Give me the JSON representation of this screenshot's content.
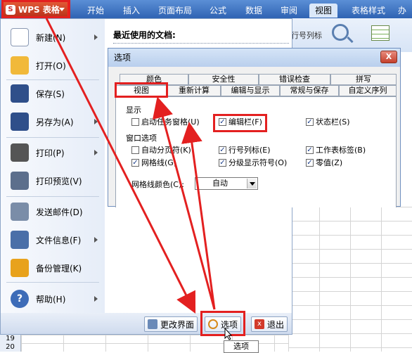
{
  "ribbon": {
    "app_label": "WPS 表格",
    "tabs": [
      "开始",
      "插入",
      "页面布局",
      "公式",
      "数据",
      "审阅",
      "视图",
      "表格样式",
      "办"
    ],
    "active_tab": "视图",
    "rowcol_label": "行号列标"
  },
  "menu": {
    "items": [
      {
        "label": "新建(N)",
        "icon": "new-file-icon",
        "color": "#ffffff",
        "arrow": true
      },
      {
        "label": "打开(O)",
        "icon": "folder-open-icon",
        "color": "#f1b93a",
        "arrow": false
      },
      {
        "label": "保存(S)",
        "icon": "save-icon",
        "color": "#2f4f8a",
        "arrow": false
      },
      {
        "label": "另存为(A)",
        "icon": "save-as-icon",
        "color": "#2f4f8a",
        "arrow": true
      },
      {
        "label": "打印(P)",
        "icon": "printer-icon",
        "color": "#555555",
        "arrow": true
      },
      {
        "label": "打印预览(V)",
        "icon": "print-preview-icon",
        "color": "#5c6f8c",
        "arrow": false
      },
      {
        "label": "发送邮件(D)",
        "icon": "mail-icon",
        "color": "#7a8da8",
        "arrow": false
      },
      {
        "label": "文件信息(F)",
        "icon": "file-info-icon",
        "color": "#4a6fa8",
        "arrow": true
      },
      {
        "label": "备份管理(K)",
        "icon": "backup-icon",
        "color": "#e8a21c",
        "arrow": false
      },
      {
        "label": "帮助(H)",
        "icon": "help-icon",
        "color": "#3d6cb8",
        "arrow": true
      }
    ],
    "recent_header": "最近使用的文档:",
    "footer": {
      "change_ui": "更改界面",
      "options": "选项",
      "exit": "退出"
    }
  },
  "dialog": {
    "title": "选项",
    "close": "X",
    "tabs_row1": [
      "颜色",
      "安全性",
      "错误检查",
      "拼写"
    ],
    "tabs_row2": [
      "视图",
      "重新计算",
      "编辑与显示",
      "常规与保存",
      "自定义序列"
    ],
    "selected_tab": "视图",
    "display_group": "显示",
    "display": [
      {
        "label": "启动任务窗格(U)",
        "checked": false
      },
      {
        "label": "编辑栏(F)",
        "checked": true
      },
      {
        "label": "状态栏(S)",
        "checked": true
      }
    ],
    "window_group": "窗口选项",
    "window": [
      {
        "label": "自动分页符(K)",
        "checked": false
      },
      {
        "label": "行号列标(E)",
        "checked": true
      },
      {
        "label": "工作表标签(B)",
        "checked": true
      },
      {
        "label": "网格线(G)",
        "checked": true
      },
      {
        "label": "分级显示符号(O)",
        "checked": true
      },
      {
        "label": "零值(Z)",
        "checked": true
      }
    ],
    "gridcolor_label": "网格线颜色(C):",
    "gridcolor_value": "自动"
  },
  "tooltip": "选项",
  "row_numbers": [
    "19",
    "20"
  ],
  "accent": "#e32020"
}
